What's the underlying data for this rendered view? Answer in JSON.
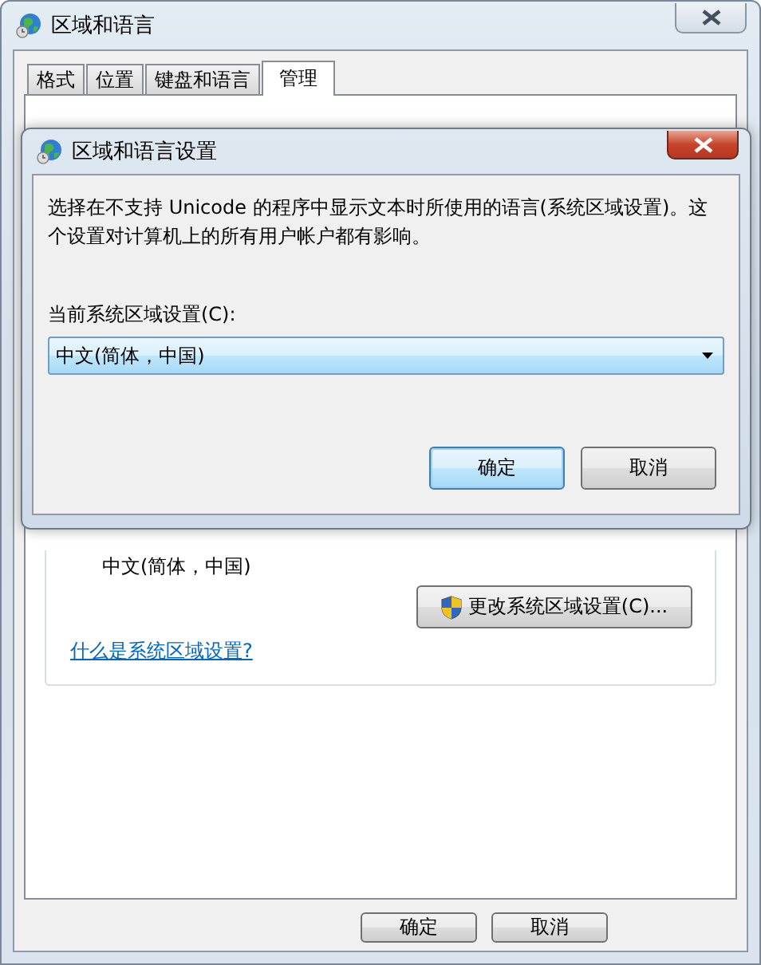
{
  "window": {
    "title": "区域和语言"
  },
  "tabs": [
    {
      "label": "格式",
      "selected": false
    },
    {
      "label": "位置",
      "selected": false
    },
    {
      "label": "键盘和语言",
      "selected": false
    },
    {
      "label": "管理",
      "selected": true
    }
  ],
  "admin_panel": {
    "current_locale": "中文(简体，中国)",
    "change_button": "更改系统区域设置(C)...",
    "help_link": "什么是系统区域设置?"
  },
  "buttons": [
    {
      "label": "确定"
    },
    {
      "label": "取消"
    }
  ],
  "dialog": {
    "title": "区域和语言设置",
    "description": "选择在不支持 Unicode 的程序中显示文本时所使用的语言(系统区域设置)。这个设置对计算机上的所有用户帐户都有影响。",
    "field_label": "当前系统区域设置(C):",
    "dropdown": {
      "value": "中文(简体，中国)"
    },
    "buttons": [
      {
        "label": "确定",
        "default": true
      },
      {
        "label": "取消",
        "default": false
      }
    ]
  }
}
